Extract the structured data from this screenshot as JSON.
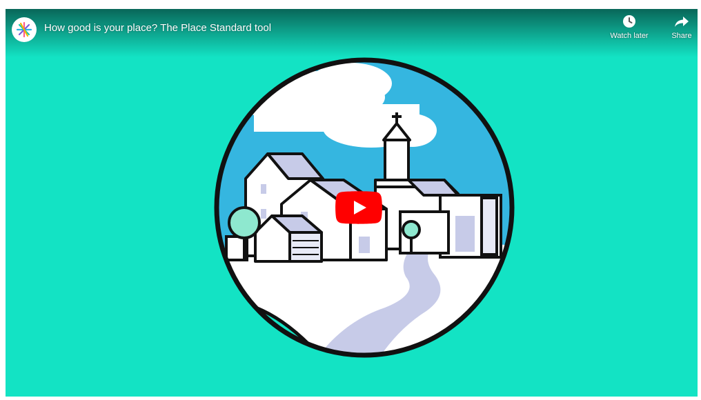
{
  "video": {
    "title": "How good is your place? The Place Standard tool"
  },
  "actions": {
    "watch_later_label": "Watch later",
    "share_label": "Share"
  },
  "icons": {
    "channel": "place-standard-logo-icon",
    "watch_later": "clock-icon",
    "share": "share-arrow-icon",
    "play": "youtube-play-icon"
  },
  "colors": {
    "background": "#13e3c4",
    "sky": "#35b6e0",
    "play_button": "#ff0000",
    "road": "#c7cbe8"
  }
}
